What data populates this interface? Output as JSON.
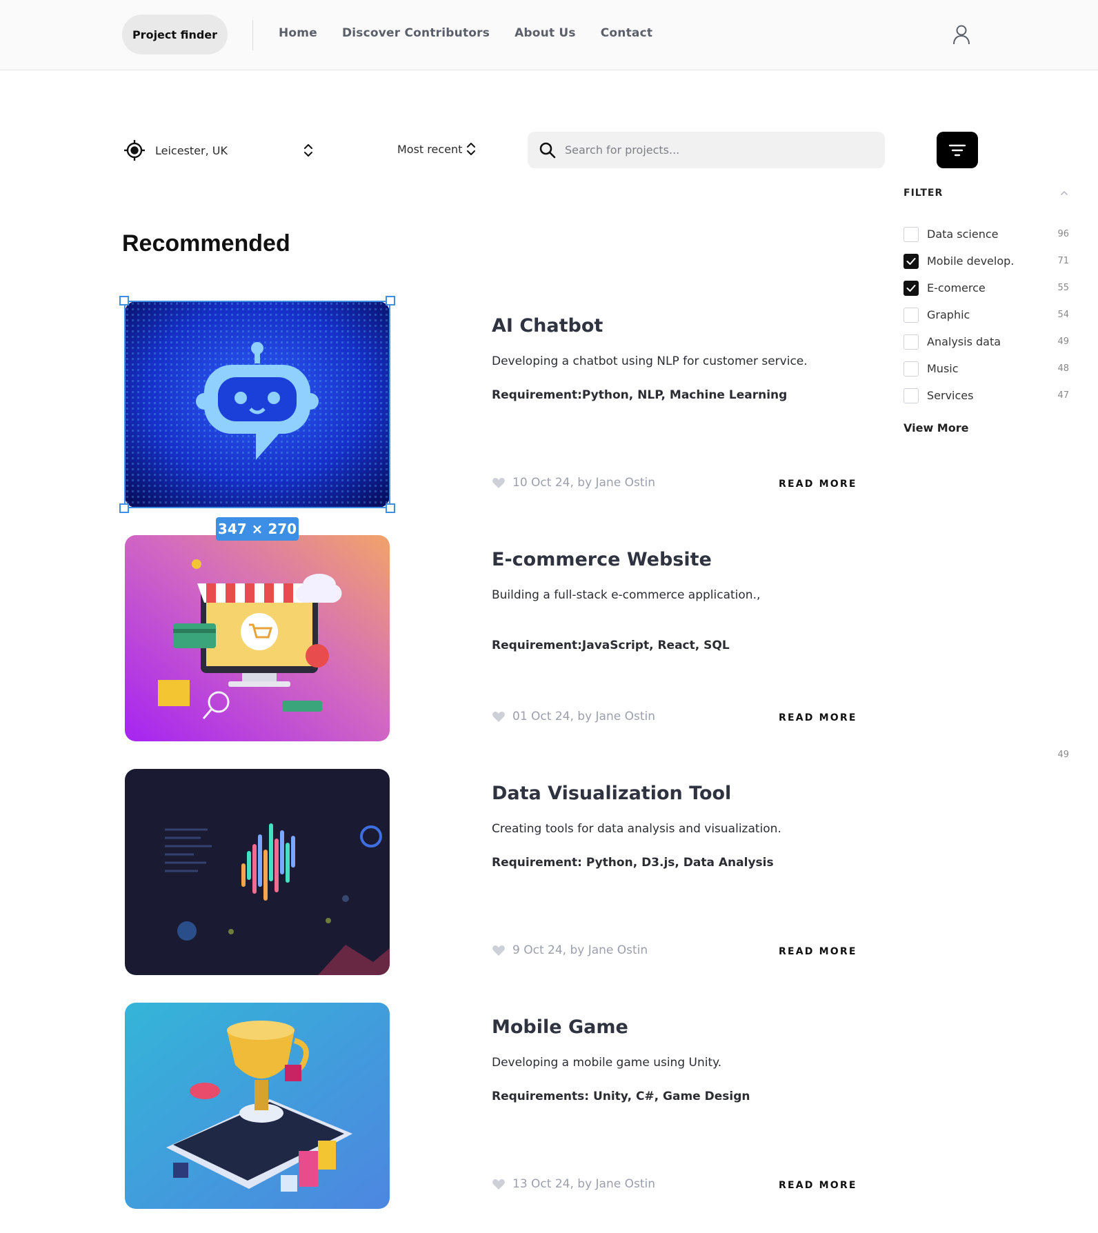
{
  "header": {
    "brand": "Project finder",
    "nav": [
      {
        "label": "Home"
      },
      {
        "label": "Discover Contributors"
      },
      {
        "label": "About Us"
      },
      {
        "label": "Contact"
      }
    ],
    "user_icon": "user-icon"
  },
  "toolbar": {
    "location": "Leicester, UK",
    "sort": "Most recent",
    "search_placeholder": "Search for projects...",
    "filter_icon": "filter-icon"
  },
  "filter": {
    "title": "FILTER",
    "items": [
      {
        "label": "Data science",
        "count": "96",
        "checked": false
      },
      {
        "label": "Mobile develop.",
        "count": "71",
        "checked": true
      },
      {
        "label": "E-comerce",
        "count": "55",
        "checked": true
      },
      {
        "label": "Graphic",
        "count": "54",
        "checked": false
      },
      {
        "label": "Analysis data",
        "count": "49",
        "checked": false
      },
      {
        "label": "Music",
        "count": "48",
        "checked": false
      },
      {
        "label": "Services",
        "count": "47",
        "checked": false
      }
    ],
    "view_more": "View More",
    "stray_count": "49"
  },
  "recommended": {
    "title": "Recommended",
    "read_more": "READ MORE",
    "projects": [
      {
        "title": "AI Chatbot",
        "description": "Developing a chatbot using NLP for customer service.",
        "requirement": "Requirement:Python, NLP, Machine Learning",
        "meta": "10 Oct 24, by Jane Ostin",
        "image": "ai-chatbot-illustration"
      },
      {
        "title": "E-commerce Website",
        "description": "Building a full-stack e-commerce application.,",
        "requirement": "Requirement:JavaScript, React, SQL",
        "meta": "01 Oct 24, by Jane Ostin",
        "image": "ecommerce-illustration"
      },
      {
        "title": "Data Visualization Tool",
        "description": "Creating tools for data analysis and visualization.",
        "requirement": "Requirement: Python, D3.js, Data Analysis",
        "meta": "9 Oct 24, by Jane Ostin",
        "image": "data-visualization-illustration"
      },
      {
        "title": "Mobile Game",
        "description": "Developing a mobile game using Unity.",
        "requirement": "Requirements: Unity, C#, Game Design",
        "meta": "13 Oct 24, by Jane Ostin",
        "image": "mobile-game-illustration"
      }
    ]
  },
  "selection_badge": "347 × 270",
  "colors": {
    "accent_selection": "#3d8fe6",
    "filter_button": "#000000",
    "muted_text": "#9a9fab"
  }
}
